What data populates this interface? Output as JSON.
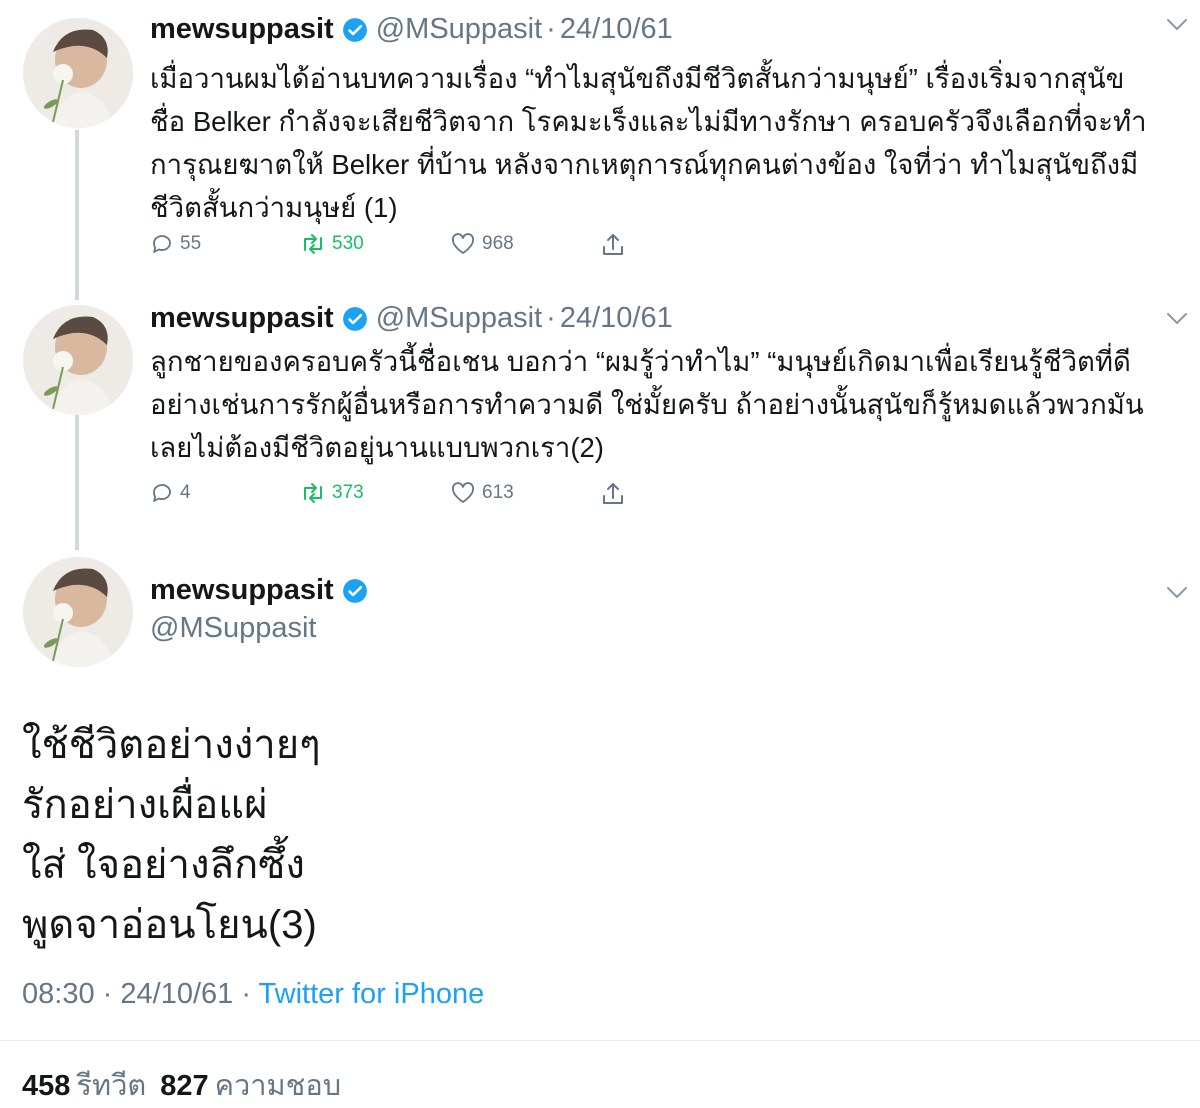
{
  "tweets": [
    {
      "display_name": "mewsuppasit",
      "handle": "@MSuppasit",
      "separator": "·",
      "date": "24/10/61",
      "lines": [
        "เมื่อวานผมได้อ่านบทความเรื่อง “ทำไมสุนัขถึงมีชีวิตสั้นกว่ามนุษย์” เรื่องเริ่มจากสุนัข",
        "ชื่อ Belker กำลังจะเสียชีวิตจาก โรคมะเร็งและไม่มีทางรักษา ครอบครัวจึงเลือกที่จะทำ",
        "การุณยฆาตให้ Belker ที่บ้าน หลังจากเหตุการณ์ทุกคนต่างข้อง ใจที่ว่า ทำไมสุนัขถึงมี",
        "ชีวิตสั้นกว่ามนุษย์ (1)"
      ],
      "replies": "55",
      "retweets": "530",
      "likes": "968"
    },
    {
      "display_name": "mewsuppasit",
      "handle": "@MSuppasit",
      "separator": "·",
      "date": "24/10/61",
      "lines": [
        "ลูกชายของครอบครัวนี้ชื่อเชน บอกว่า “ผมรู้ว่าทำไม” “มนุษย์เกิดมาเพื่อเรียนรู้ชีวิตที่ดี",
        "อย่างเช่นการรักผู้อื่นหรือการทำความดี ใช่มั้ยครับ ถ้าอย่างนั้นสุนัขก็รู้หมดแล้วพวกมัน",
        "เลยไม่ต้องมีชีวิตอยู่นานแบบพวกเรา(2)"
      ],
      "replies": "4",
      "retweets": "373",
      "likes": "613"
    }
  ],
  "main_tweet": {
    "display_name": "mewsuppasit",
    "handle": "@MSuppasit",
    "lines": [
      "ใช้ชีวิตอย่างง่ายๆ",
      "รักอย่างเผื่อแผ่",
      "ใส่ ใจอย่างลึกซึ้ง",
      "พูดจาอ่อนโยน(3)"
    ],
    "time": "08:30",
    "separator": "·",
    "date": "24/10/61",
    "separator2": "·",
    "source": "Twitter for iPhone",
    "retweet_count": "458",
    "retweet_label": "รีทวีต",
    "like_count": "827",
    "like_label": "ความชอบ"
  },
  "colors": {
    "verified": "#1da1f2",
    "retweet_active": "#17bf63",
    "secondary_text": "#657786",
    "link": "#1da1f2"
  },
  "icons": {
    "verified": "verified-badge-icon",
    "reply": "reply-bubble-icon",
    "retweet": "retweet-icon",
    "like": "heart-icon",
    "share": "share-icon",
    "more": "chevron-down-icon"
  }
}
